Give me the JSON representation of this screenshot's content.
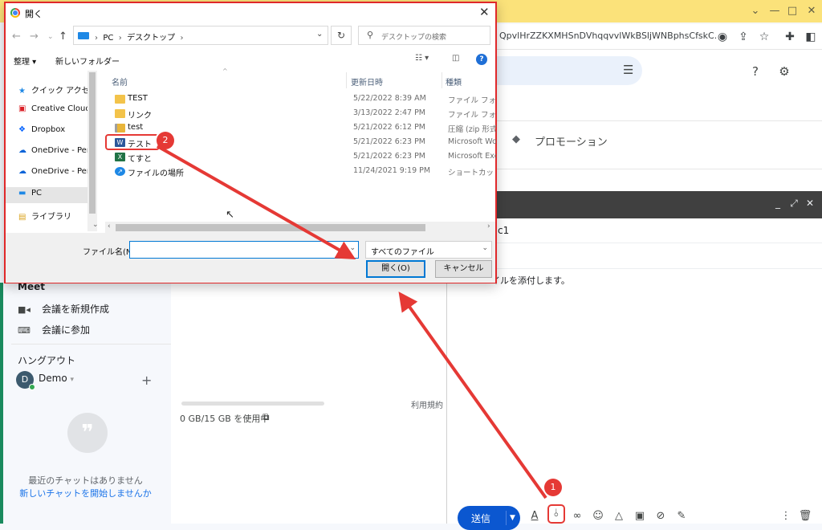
{
  "browser": {
    "url": "QpvlHrZZKXMHSnDVhqqvvlWkBSljWNBphsCfskC...",
    "window_controls": [
      "⌄",
      "—",
      "□",
      "✕"
    ]
  },
  "gmail": {
    "promotions_label": "プロモーション",
    "meet": {
      "title": "Meet",
      "new_meeting": "会議を新規作成",
      "join_meeting": "会議に参加"
    },
    "hangouts": {
      "title": "ハングアウト",
      "avatar_letter": "D",
      "user_name": "Demo",
      "user_dropdown": "▾",
      "add": "+",
      "no_chats": "最近のチャットはありません",
      "start_chat": "新しいチャットを開始しませんか"
    },
    "storage": "0 GB/15 GB を使用中",
    "terms": "利用規約 ·"
  },
  "compose": {
    "subject_fragment": "c1",
    "body_fragment": "イルを添付します。",
    "send_label": "送信"
  },
  "badges": {
    "step1": "1",
    "step2": "2"
  },
  "dialog": {
    "title": "開く",
    "path": [
      "PC",
      "デスクトップ"
    ],
    "search_placeholder": "デスクトップの検索",
    "organize": "整理 ▾",
    "new_folder": "新しいフォルダー",
    "help": "?",
    "nav": [
      {
        "label": "クイック アクセス",
        "icon": "star-icon"
      },
      {
        "label": "Creative Cloud Fil",
        "icon": "creative-cloud-icon"
      },
      {
        "label": "Dropbox",
        "icon": "dropbox-icon"
      },
      {
        "label": "OneDrive - Perso",
        "icon": "onedrive-icon"
      },
      {
        "label": "OneDrive - Perso",
        "icon": "onedrive-icon"
      },
      {
        "label": "PC",
        "icon": "pc-icon"
      },
      {
        "label": "ライブラリ",
        "icon": "library-icon"
      }
    ],
    "columns": {
      "name": "名前",
      "modified": "更新日時",
      "type": "種類"
    },
    "files": [
      {
        "name": "TEST",
        "date": "5/22/2022 8:39 AM",
        "type": "ファイル フォルダー",
        "icon": "folder-icon"
      },
      {
        "name": "リンク",
        "date": "3/13/2022 2:47 PM",
        "type": "ファイル フォルダー",
        "icon": "folder-icon"
      },
      {
        "name": "test",
        "date": "5/21/2022 6:12 PM",
        "type": "圧縮 (zip 形式)",
        "icon": "zip-folder-icon"
      },
      {
        "name": "テスト",
        "date": "5/21/2022 6:23 PM",
        "type": "Microsoft Word",
        "icon": "word-file-icon"
      },
      {
        "name": "てすと",
        "date": "5/21/2022 6:23 PM",
        "type": "Microsoft Excel",
        "icon": "excel-file-icon"
      },
      {
        "name": "ファイルの場所",
        "date": "11/24/2021 9:19 PM",
        "type": "ショートカット",
        "icon": "shortcut-icon"
      }
    ],
    "filename_label": "ファイル名(N):",
    "filename_value": "",
    "filetype": "すべてのファイル",
    "open_button": "開く(O)",
    "cancel_button": "キャンセル"
  },
  "colors": {
    "highlight_red": "#e53935",
    "browser_yellow": "#fbe27a",
    "send_blue": "#0b57d0",
    "dialog_accent": "#0078d4"
  }
}
